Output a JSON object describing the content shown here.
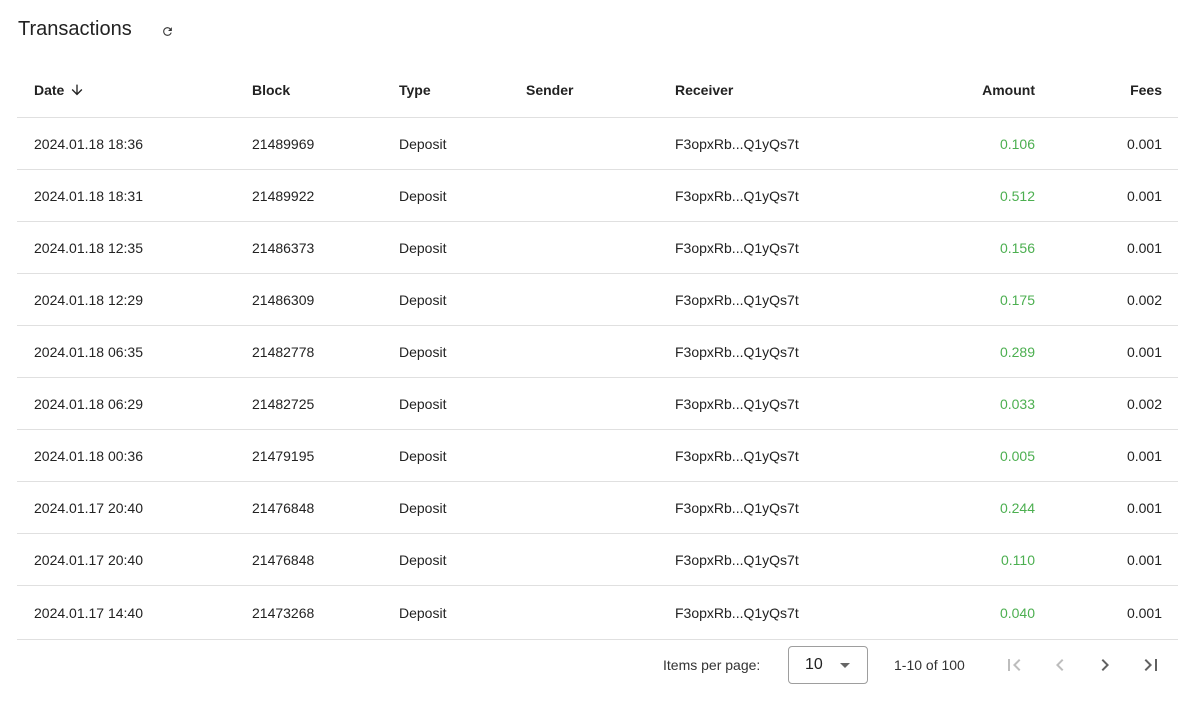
{
  "header": {
    "title": "Transactions",
    "refresh_icon": "refresh-icon"
  },
  "columns": {
    "date": "Date",
    "block": "Block",
    "type": "Type",
    "sender": "Sender",
    "receiver": "Receiver",
    "amount": "Amount",
    "fees": "Fees"
  },
  "sort": {
    "column": "date",
    "direction": "desc",
    "icon": "arrow-down-icon"
  },
  "rows": [
    {
      "date": "2024.01.18 18:36",
      "block": "21489969",
      "type": "Deposit",
      "sender": "",
      "receiver": "F3opxRb...Q1yQs7t",
      "amount": "0.106",
      "fees": "0.001"
    },
    {
      "date": "2024.01.18 18:31",
      "block": "21489922",
      "type": "Deposit",
      "sender": "",
      "receiver": "F3opxRb...Q1yQs7t",
      "amount": "0.512",
      "fees": "0.001"
    },
    {
      "date": "2024.01.18 12:35",
      "block": "21486373",
      "type": "Deposit",
      "sender": "",
      "receiver": "F3opxRb...Q1yQs7t",
      "amount": "0.156",
      "fees": "0.001"
    },
    {
      "date": "2024.01.18 12:29",
      "block": "21486309",
      "type": "Deposit",
      "sender": "",
      "receiver": "F3opxRb...Q1yQs7t",
      "amount": "0.175",
      "fees": "0.002"
    },
    {
      "date": "2024.01.18 06:35",
      "block": "21482778",
      "type": "Deposit",
      "sender": "",
      "receiver": "F3opxRb...Q1yQs7t",
      "amount": "0.289",
      "fees": "0.001"
    },
    {
      "date": "2024.01.18 06:29",
      "block": "21482725",
      "type": "Deposit",
      "sender": "",
      "receiver": "F3opxRb...Q1yQs7t",
      "amount": "0.033",
      "fees": "0.002"
    },
    {
      "date": "2024.01.18 00:36",
      "block": "21479195",
      "type": "Deposit",
      "sender": "",
      "receiver": "F3opxRb...Q1yQs7t",
      "amount": "0.005",
      "fees": "0.001"
    },
    {
      "date": "2024.01.17 20:40",
      "block": "21476848",
      "type": "Deposit",
      "sender": "",
      "receiver": "F3opxRb...Q1yQs7t",
      "amount": "0.244",
      "fees": "0.001"
    },
    {
      "date": "2024.01.17 20:40",
      "block": "21476848",
      "type": "Deposit",
      "sender": "",
      "receiver": "F3opxRb...Q1yQs7t",
      "amount": "0.110",
      "fees": "0.001"
    },
    {
      "date": "2024.01.17 14:40",
      "block": "21473268",
      "type": "Deposit",
      "sender": "",
      "receiver": "F3opxRb...Q1yQs7t",
      "amount": "0.040",
      "fees": "0.001"
    }
  ],
  "colors": {
    "amount": "#4caf50",
    "divider": "#e0e0e0",
    "disabled_icon": "#bdbdbd",
    "active_icon": "#616161"
  },
  "paginator": {
    "items_per_page_label": "Items per page:",
    "items_per_page_value": "10",
    "range_label": "1-10 of 100",
    "buttons": [
      {
        "icon": "first-page-icon",
        "enabled": false
      },
      {
        "icon": "chevron-left-icon",
        "enabled": false
      },
      {
        "icon": "chevron-right-icon",
        "enabled": true
      },
      {
        "icon": "last-page-icon",
        "enabled": true
      }
    ]
  }
}
